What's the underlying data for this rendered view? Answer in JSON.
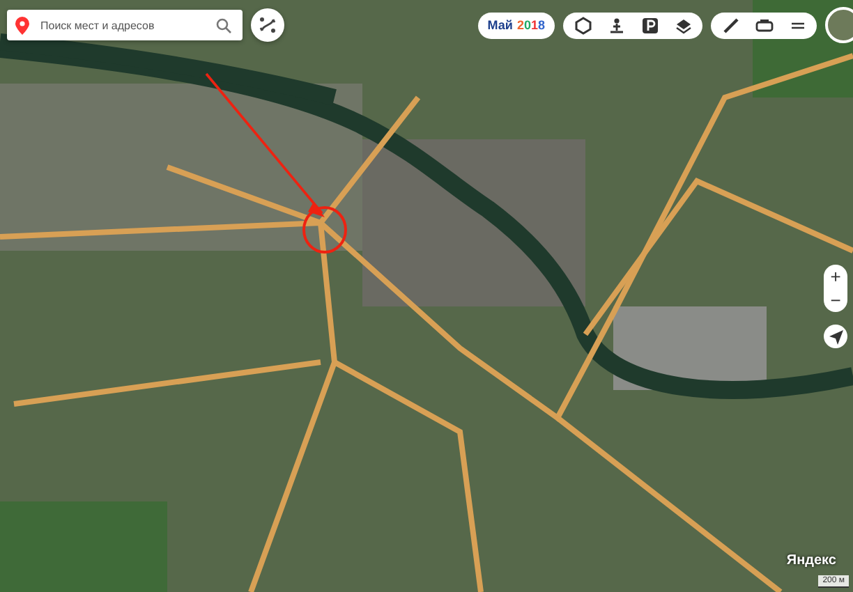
{
  "search": {
    "placeholder": "Поиск мест и адресов"
  },
  "date_badge": {
    "month": "Май",
    "year": "2018"
  },
  "zoom": {
    "plus": "+",
    "minus": "−"
  },
  "logo": "Яндекс",
  "scale": "200 м"
}
